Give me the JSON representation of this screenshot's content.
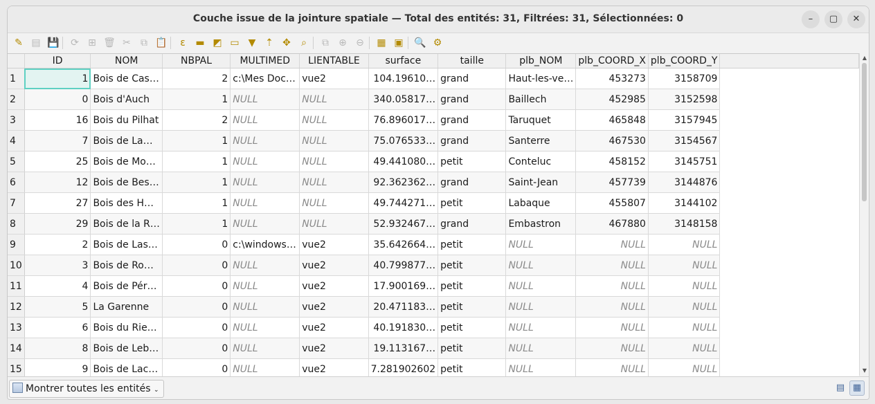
{
  "window": {
    "title": "Couche issue de la jointure spatiale — Total des entités: 31, Filtrées: 31, Sélectionnées: 0"
  },
  "window_controls": {
    "minimize": "–",
    "maximize": "▢",
    "close": "✕"
  },
  "toolbar_icons": [
    {
      "name": "toggle-editing-icon",
      "glyph": "✎",
      "enabled": true
    },
    {
      "name": "multi-edit-icon",
      "glyph": "▤",
      "enabled": false
    },
    {
      "name": "save-edits-icon",
      "glyph": "💾",
      "enabled": false
    },
    {
      "name": "reload-icon",
      "glyph": "⟳",
      "enabled": false
    },
    {
      "name": "add-feature-icon",
      "glyph": "⊞",
      "enabled": false
    },
    {
      "name": "delete-feature-icon",
      "glyph": "🗑",
      "enabled": false
    },
    {
      "name": "cut-icon",
      "glyph": "✂",
      "enabled": false
    },
    {
      "name": "copy-icon",
      "glyph": "⧉",
      "enabled": false
    },
    {
      "name": "paste-icon",
      "glyph": "📋",
      "enabled": false
    },
    {
      "name": "select-by-expression-icon",
      "glyph": "ε",
      "enabled": true
    },
    {
      "name": "select-all-icon",
      "glyph": "▬",
      "enabled": true
    },
    {
      "name": "invert-selection-icon",
      "glyph": "◩",
      "enabled": true
    },
    {
      "name": "deselect-all-icon",
      "glyph": "▭",
      "enabled": true
    },
    {
      "name": "filter-selection-icon",
      "glyph": "▼",
      "enabled": true
    },
    {
      "name": "move-selection-to-top-icon",
      "glyph": "⇡",
      "enabled": true
    },
    {
      "name": "pan-to-selection-icon",
      "glyph": "✥",
      "enabled": true
    },
    {
      "name": "zoom-to-selection-icon",
      "glyph": "⌕",
      "enabled": true
    },
    {
      "name": "copy-rows-icon",
      "glyph": "⧉",
      "enabled": false
    },
    {
      "name": "new-field-icon",
      "glyph": "⊕",
      "enabled": false
    },
    {
      "name": "delete-field-icon",
      "glyph": "⊖",
      "enabled": false
    },
    {
      "name": "field-calculator-icon",
      "glyph": "▦",
      "enabled": true
    },
    {
      "name": "conditional-formatting-icon",
      "glyph": "▣",
      "enabled": true
    },
    {
      "name": "zoom-map-icon",
      "glyph": "🔍",
      "enabled": true
    },
    {
      "name": "actions-icon",
      "glyph": "⚙",
      "enabled": true
    }
  ],
  "columns": [
    "ID",
    "NOM",
    "NBPAL",
    "MULTIMED",
    "LIENTABLE",
    "surface",
    "taille",
    "plb_NOM",
    "plb_COORD_X",
    "plb_COORD_Y"
  ],
  "rows": [
    {
      "n": "1",
      "ID": "1",
      "NOM": "Bois de Cas…",
      "NBPAL": "2",
      "MULTIMED": "c:\\Mes Doc…",
      "LIENTABLE": "vue2",
      "surface": "104.19610…",
      "taille": "grand",
      "plb_NOM": "Haut-les-ve…",
      "plb_COORD_X": "453273",
      "plb_COORD_Y": "3158709"
    },
    {
      "n": "2",
      "ID": "0",
      "NOM": "Bois d'Auch",
      "NBPAL": "1",
      "MULTIMED": "NULL",
      "LIENTABLE": "NULL",
      "surface": "340.05817…",
      "taille": "grand",
      "plb_NOM": "Baillech",
      "plb_COORD_X": "452985",
      "plb_COORD_Y": "3152598"
    },
    {
      "n": "3",
      "ID": "16",
      "NOM": "Bois du Pilhat",
      "NBPAL": "2",
      "MULTIMED": "NULL",
      "LIENTABLE": "NULL",
      "surface": "76.896017…",
      "taille": "grand",
      "plb_NOM": "Taruquet",
      "plb_COORD_X": "465848",
      "plb_COORD_Y": "3157945"
    },
    {
      "n": "4",
      "ID": "7",
      "NOM": "Bois de La…",
      "NBPAL": "1",
      "MULTIMED": "NULL",
      "LIENTABLE": "NULL",
      "surface": "75.076533…",
      "taille": "grand",
      "plb_NOM": "Santerre",
      "plb_COORD_X": "467530",
      "plb_COORD_Y": "3154567"
    },
    {
      "n": "5",
      "ID": "25",
      "NOM": "Bois de Mo…",
      "NBPAL": "1",
      "MULTIMED": "NULL",
      "LIENTABLE": "NULL",
      "surface": "49.441080…",
      "taille": "petit",
      "plb_NOM": "Conteluc",
      "plb_COORD_X": "458152",
      "plb_COORD_Y": "3145751"
    },
    {
      "n": "6",
      "ID": "12",
      "NOM": "Bois de Bes…",
      "NBPAL": "1",
      "MULTIMED": "NULL",
      "LIENTABLE": "NULL",
      "surface": "92.362362…",
      "taille": "grand",
      "plb_NOM": "Saint-Jean",
      "plb_COORD_X": "457739",
      "plb_COORD_Y": "3144876"
    },
    {
      "n": "7",
      "ID": "27",
      "NOM": "Bois des H…",
      "NBPAL": "1",
      "MULTIMED": "NULL",
      "LIENTABLE": "NULL",
      "surface": "49.744271…",
      "taille": "petit",
      "plb_NOM": "Labaque",
      "plb_COORD_X": "455807",
      "plb_COORD_Y": "3144102"
    },
    {
      "n": "8",
      "ID": "29",
      "NOM": "Bois de la R…",
      "NBPAL": "1",
      "MULTIMED": "NULL",
      "LIENTABLE": "NULL",
      "surface": "52.932467…",
      "taille": "grand",
      "plb_NOM": "Embastron",
      "plb_COORD_X": "467880",
      "plb_COORD_Y": "3148158"
    },
    {
      "n": "9",
      "ID": "2",
      "NOM": "Bois de Las…",
      "NBPAL": "0",
      "MULTIMED": "c:\\windows…",
      "LIENTABLE": "vue2",
      "surface": "35.642664…",
      "taille": "petit",
      "plb_NOM": "NULL",
      "plb_COORD_X": "NULL",
      "plb_COORD_Y": "NULL"
    },
    {
      "n": "10",
      "ID": "3",
      "NOM": "Bois de Ro…",
      "NBPAL": "0",
      "MULTIMED": "NULL",
      "LIENTABLE": "vue2",
      "surface": "40.799877…",
      "taille": "petit",
      "plb_NOM": "NULL",
      "plb_COORD_X": "NULL",
      "plb_COORD_Y": "NULL"
    },
    {
      "n": "11",
      "ID": "4",
      "NOM": "Bois de Pér…",
      "NBPAL": "0",
      "MULTIMED": "NULL",
      "LIENTABLE": "vue2",
      "surface": "17.900169…",
      "taille": "petit",
      "plb_NOM": "NULL",
      "plb_COORD_X": "NULL",
      "plb_COORD_Y": "NULL"
    },
    {
      "n": "12",
      "ID": "5",
      "NOM": "La Garenne",
      "NBPAL": "0",
      "MULTIMED": "NULL",
      "LIENTABLE": "vue2",
      "surface": "20.471183…",
      "taille": "petit",
      "plb_NOM": "NULL",
      "plb_COORD_X": "NULL",
      "plb_COORD_Y": "NULL"
    },
    {
      "n": "13",
      "ID": "6",
      "NOM": "Bois du Rie…",
      "NBPAL": "0",
      "MULTIMED": "NULL",
      "LIENTABLE": "vue2",
      "surface": "40.191830…",
      "taille": "petit",
      "plb_NOM": "NULL",
      "plb_COORD_X": "NULL",
      "plb_COORD_Y": "NULL"
    },
    {
      "n": "14",
      "ID": "8",
      "NOM": "Bois de Leb…",
      "NBPAL": "0",
      "MULTIMED": "NULL",
      "LIENTABLE": "vue2",
      "surface": "19.113167…",
      "taille": "petit",
      "plb_NOM": "NULL",
      "plb_COORD_X": "NULL",
      "plb_COORD_Y": "NULL"
    },
    {
      "n": "15",
      "ID": "9",
      "NOM": "Bois de Lac…",
      "NBPAL": "0",
      "MULTIMED": "NULL",
      "LIENTABLE": "vue2",
      "surface": "7.281902602",
      "taille": "petit",
      "plb_NOM": "NULL",
      "plb_COORD_X": "NULL",
      "plb_COORD_Y": "NULL"
    }
  ],
  "bottom": {
    "filter_label": "Montrer toutes les entités",
    "form_view_icon": "form-view-icon",
    "table_view_icon": "table-view-icon"
  }
}
